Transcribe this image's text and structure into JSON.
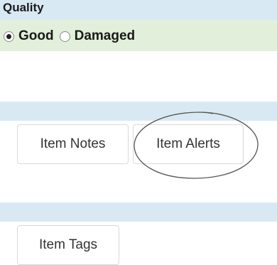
{
  "quality": {
    "title": "Quality",
    "options": [
      {
        "label": "Good",
        "checked": true
      },
      {
        "label": "Damaged",
        "checked": false
      }
    ]
  },
  "buttons": {
    "item_notes": "Item Notes",
    "item_alerts": "Item Alerts",
    "item_tags": "Item Tags"
  },
  "colors": {
    "section_band_blue": "#d8e9f4",
    "section_band_green": "#e2efda"
  }
}
